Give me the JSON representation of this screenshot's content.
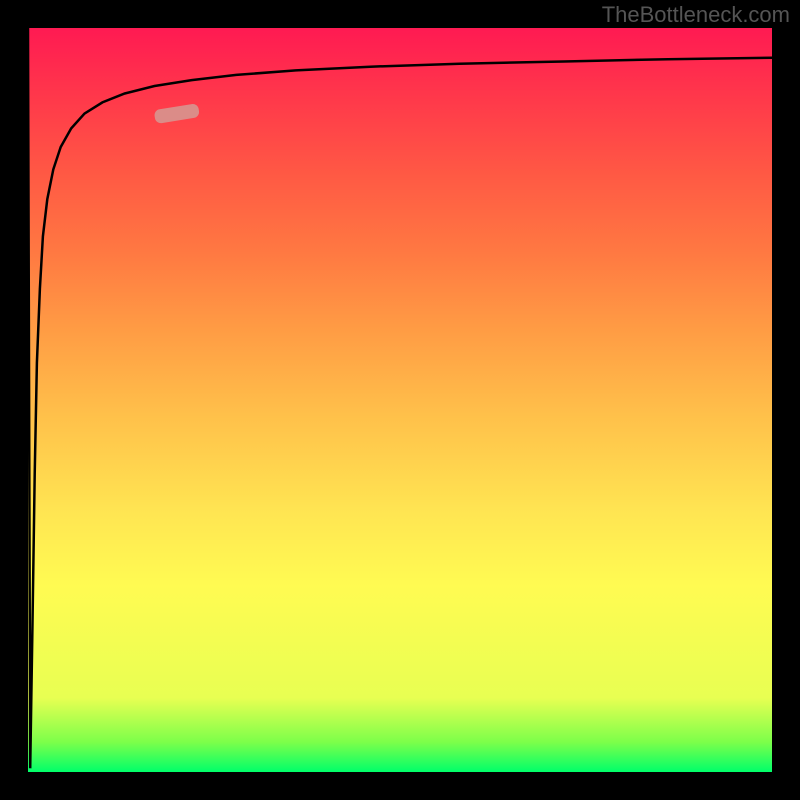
{
  "watermark": "TheBottleneck.com",
  "chart_data": {
    "type": "line",
    "title": "",
    "xlabel": "",
    "ylabel": "",
    "xlim": [
      0,
      100
    ],
    "ylim": [
      0,
      100
    ],
    "background_gradient": {
      "direction": "vertical",
      "stops": [
        {
          "pos": 0,
          "color": "#00ff6a"
        },
        {
          "pos": 4,
          "color": "#7cff4a"
        },
        {
          "pos": 10,
          "color": "#e8ff52"
        },
        {
          "pos": 25,
          "color": "#fffb52"
        },
        {
          "pos": 48,
          "color": "#ffc04a"
        },
        {
          "pos": 70,
          "color": "#ff7842"
        },
        {
          "pos": 90,
          "color": "#ff3a4a"
        },
        {
          "pos": 100,
          "color": "#ff1a52"
        }
      ]
    },
    "series": [
      {
        "name": "curve",
        "color": "#000000",
        "x": [
          0.0,
          0.3,
          0.6,
          0.9,
          1.2,
          1.6,
          2.0,
          2.6,
          3.4,
          4.4,
          5.8,
          7.6,
          10.0,
          13.0,
          17.0,
          22.0,
          28.0,
          36.0,
          46.0,
          58.0,
          72.0,
          86.0,
          100.0
        ],
        "y": [
          100.0,
          0.5,
          20.0,
          40.0,
          55.0,
          65.0,
          72.0,
          77.0,
          81.0,
          84.0,
          86.5,
          88.5,
          90.0,
          91.2,
          92.2,
          93.0,
          93.7,
          94.3,
          94.8,
          95.2,
          95.5,
          95.8,
          96.0
        ]
      }
    ],
    "marker": {
      "name": "highlight-segment",
      "x": 20.0,
      "y": 88.5,
      "color": "#d8938e",
      "length_pct": 6
    },
    "grid": false,
    "legend": false
  }
}
